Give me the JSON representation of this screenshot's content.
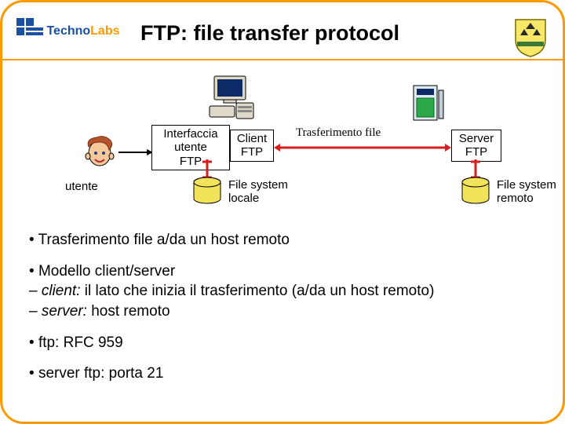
{
  "header": {
    "title": "FTP: file transfer protocol",
    "logo_part1": "Techno",
    "logo_part2": "Labs"
  },
  "diagram": {
    "user_label": "utente",
    "box_interface": "Interfaccia\nutente\nFTP",
    "box_client": "Client\nFTP",
    "box_server": "Server\nFTP",
    "transfer_label": "Trasferimento file",
    "fs_local": "File system\nlocale",
    "fs_remote": "File system\nremoto"
  },
  "bullets": {
    "b1": "Trasferimento file a/da un host remoto",
    "b2": "Modello client/server",
    "b2a_prefix": "client:",
    "b2a_rest": " il lato che inizia il trasferimento (a/da un host remoto)",
    "b2b_prefix": "server:",
    "b2b_rest": " host remoto",
    "b3": "ftp: RFC 959",
    "b4": "server ftp: porta 21"
  }
}
